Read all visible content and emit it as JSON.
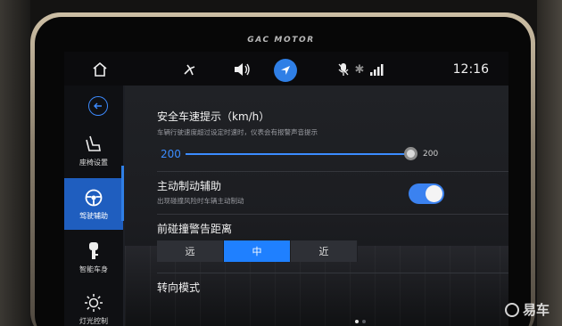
{
  "device": {
    "brand": "GAC MOTOR"
  },
  "statusbar": {
    "time": "12:16",
    "icons": [
      "home-icon",
      "ac-fan-icon",
      "volume-icon",
      "navigation-icon",
      "mute-mic-icon",
      "bluetooth-icon",
      "signal-icon"
    ]
  },
  "sidebar": {
    "items": [
      {
        "label": "座椅设置",
        "icon": "seat-icon"
      },
      {
        "label": "驾驶辅助",
        "icon": "steering-wheel-icon",
        "active": true
      },
      {
        "label": "智能车身",
        "icon": "key-icon"
      },
      {
        "label": "灯光控制",
        "icon": "light-icon"
      }
    ]
  },
  "settings": {
    "speed_warning": {
      "title": "安全车速提示（km/h）",
      "subtitle": "车辆行驶速度超过设定时速时，仪表会有报警声音提示",
      "value_left": "200",
      "value_right": "200",
      "level": 1.0
    },
    "auto_brake": {
      "title": "主动制动辅助",
      "subtitle": "出现碰撞风险时车辆主动制动",
      "enabled": true
    },
    "collision_distance": {
      "title": "前碰撞警告距离",
      "options": [
        "远",
        "中",
        "近"
      ],
      "selected": "中"
    },
    "steering_mode": {
      "title": "转向模式"
    }
  },
  "pager": {
    "pages": 2,
    "current": 1
  },
  "watermark": {
    "text": "易车"
  },
  "colors": {
    "accent": "#2f7fe6",
    "active_segment": "#1f80ff"
  }
}
